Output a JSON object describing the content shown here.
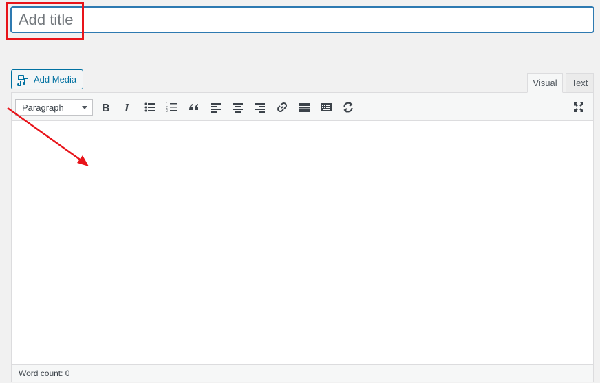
{
  "title": {
    "placeholder": "Add title",
    "value": ""
  },
  "media": {
    "add_media_label": "Add Media"
  },
  "tabs": [
    {
      "label": "Visual",
      "active": true
    },
    {
      "label": "Text",
      "active": false
    }
  ],
  "toolbar": {
    "format_selected": "Paragraph",
    "buttons": [
      "bold",
      "italic",
      "bulleted-list",
      "numbered-list",
      "blockquote",
      "align-left",
      "align-center",
      "align-right",
      "insert-link",
      "read-more",
      "toolbar-toggle",
      "undo-redo",
      "fullscreen"
    ]
  },
  "status": {
    "word_count": "Word count: 0"
  },
  "colors": {
    "accent": "#2e7ab1",
    "annotation": "#e8141a",
    "link": "#0071a1"
  }
}
